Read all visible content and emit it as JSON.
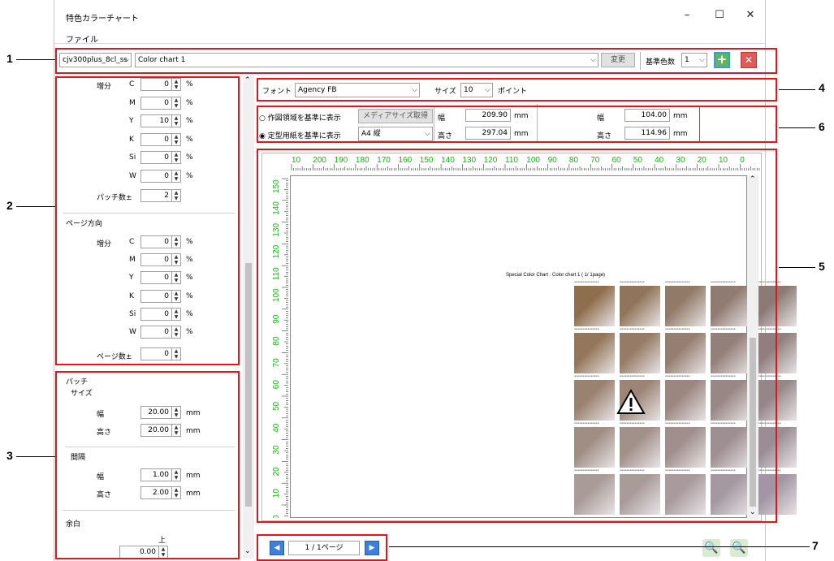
{
  "window": {
    "title": "特色カラーチャート",
    "minimize": "–",
    "maximize": "☐",
    "close": "✕",
    "menu_file": "ファイル"
  },
  "toolbar": {
    "printer_value": "cjv300plus_8cl_ss",
    "chart_value": "Color chart 1",
    "change_button": "変更",
    "base_color_label": "基準色数",
    "base_color_value": "1",
    "add_icon": "plus-icon",
    "delete_icon": "close-icon"
  },
  "increment": {
    "label": "増分",
    "rows": [
      {
        "ch": "C",
        "value": "0",
        "unit": "%"
      },
      {
        "ch": "M",
        "value": "0",
        "unit": "%"
      },
      {
        "ch": "Y",
        "value": "10",
        "unit": "%"
      },
      {
        "ch": "K",
        "value": "0",
        "unit": "%"
      },
      {
        "ch": "Si",
        "value": "0",
        "unit": "%"
      },
      {
        "ch": "W",
        "value": "0",
        "unit": "%"
      }
    ],
    "patch_count_label": "パッチ数±",
    "patch_count_value": "2"
  },
  "page_direction": {
    "title": "ページ方向",
    "label": "増分",
    "rows": [
      {
        "ch": "C",
        "value": "0",
        "unit": "%"
      },
      {
        "ch": "M",
        "value": "0",
        "unit": "%"
      },
      {
        "ch": "Y",
        "value": "0",
        "unit": "%"
      },
      {
        "ch": "K",
        "value": "0",
        "unit": "%"
      },
      {
        "ch": "Si",
        "value": "0",
        "unit": "%"
      },
      {
        "ch": "W",
        "value": "0",
        "unit": "%"
      }
    ],
    "page_count_label": "ページ数±",
    "page_count_value": "0"
  },
  "patch": {
    "title": "パッチ",
    "size_title": "サイズ",
    "width_label": "幅",
    "width_value": "20.00",
    "height_label": "高さ",
    "height_value": "20.00",
    "spacing_title": "間隔",
    "spacing_width_value": "1.00",
    "spacing_height_value": "2.00",
    "unit": "mm",
    "margin_title": "余白",
    "margin_top_label": "上",
    "margin_top_value": "0.00"
  },
  "font_bar": {
    "font_label": "フォント",
    "font_value": "Agency FB",
    "size_label": "サイズ",
    "size_value": "10",
    "point_label": "ポイント"
  },
  "layout": {
    "draw_area_option": "作図領域を基準に表示",
    "media_size_button": "メディアサイズ取得",
    "standard_paper_option": "定型用紙を基準に表示",
    "paper_value": "A4 縦",
    "width_label": "幅",
    "height_label": "高さ",
    "width_value": "209.90",
    "height_value": "297.04",
    "unit": "mm",
    "page_width_value": "104.00",
    "page_height_value": "114.96"
  },
  "preview": {
    "ruler_h": [
      "10",
      "200",
      "190",
      "180",
      "170",
      "160",
      "150",
      "140",
      "130",
      "120",
      "110",
      "100",
      "90",
      "80",
      "70",
      "60",
      "50",
      "40",
      "30",
      "20",
      "10",
      "0"
    ],
    "ruler_v": [
      "150",
      "140",
      "130",
      "120",
      "110",
      "100",
      "90",
      "80",
      "70",
      "60",
      "50",
      "40",
      "30",
      "20",
      "10",
      "0"
    ],
    "chart_caption": "Special Color Chart : Color chart 1 ( 1/ 1page)",
    "patch_colors": [
      [
        "#8e6e4d",
        "#91755a",
        "#927a68",
        "#8f7b71",
        "#8b7a76"
      ],
      [
        "#94775a",
        "#967c66",
        "#967f71",
        "#94807a",
        "#907f7e"
      ],
      [
        "#9a8270",
        "#9c8576",
        "#9b877f",
        "#988784",
        "#958688"
      ],
      [
        "#a08e84",
        "#a2908a",
        "#a08f8d",
        "#9d8f92",
        "#9a8e94"
      ],
      [
        "#a99b97",
        "#aa9b9b",
        "#a89a9d",
        "#a599a1",
        "#a296a4"
      ]
    ],
    "warning_icon": "warning-icon"
  },
  "pager": {
    "page_text": "1 / 1ページ",
    "prev_icon": "arrow-left-icon",
    "next_icon": "arrow-right-icon",
    "zoom_in_icon": "zoom-in-icon",
    "zoom_out_icon": "zoom-out-icon"
  },
  "callouts": [
    "1",
    "2",
    "3",
    "4",
    "5",
    "6",
    "7"
  ]
}
